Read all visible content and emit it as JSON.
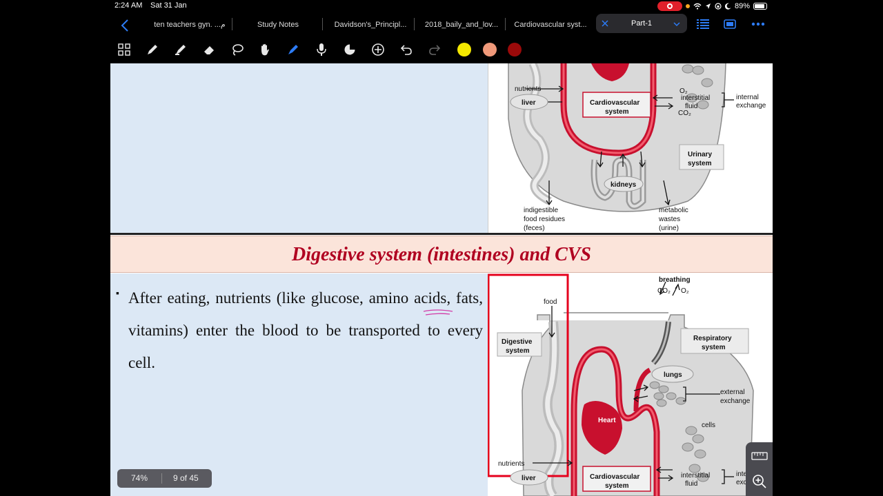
{
  "status": {
    "time": "2:24 AM",
    "date": "Sat 31 Jan",
    "battery": "89%"
  },
  "tabs": [
    {
      "label": "ten teachers gyn. ...م"
    },
    {
      "label": "Study Notes"
    },
    {
      "label": "Davidson's_Principl..."
    },
    {
      "label": "2018_baily_and_lov..."
    },
    {
      "label": "Cardiovascular syst..."
    },
    {
      "label": "Part-1"
    }
  ],
  "icons": {
    "back": "chevron-left-icon",
    "list": "list-icon",
    "layout": "page-layout-icon",
    "more": "more-icon"
  },
  "colors": {
    "yellow": "#f4e800",
    "peach": "#f0997a",
    "darkred": "#9b0a0a",
    "heading_text": "#b00020",
    "heading_bg": "#fbe4da",
    "panel_bg": "#dce8f5",
    "highlight_box": "#e5001c"
  },
  "slide": {
    "heading": "Digestive system (intestines) and CVS",
    "bullet_text": "After eating, nutrients (like glucose, amino acids, fats, vitamins) enter the blood to be transported to every cell."
  },
  "diagram_top": {
    "nutrients": "nutrients",
    "liver": "liver",
    "cv_line1": "Cardiovascular",
    "cv_line2": "system",
    "o2": "O₂",
    "co2": "CO₂",
    "interstitial1": "interstitial",
    "interstitial2": "fluid",
    "internal1": "internal",
    "internal2": "exchange",
    "urinary1": "Urinary",
    "urinary2": "system",
    "kidneys": "kidneys",
    "feces1": "indigestible",
    "feces2": "food residues",
    "feces3": "(feces)",
    "waste1": "metabolic",
    "waste2": "wastes",
    "waste3": "(urine)"
  },
  "diagram_bottom": {
    "breathing": "breathing",
    "co2": "CO₂",
    "o2": "O₂",
    "food": "food",
    "digestive1": "Digestive",
    "digestive2": "system",
    "respiratory1": "Respiratory",
    "respiratory2": "system",
    "lungs": "lungs",
    "external1": "external",
    "external2": "exchange",
    "heart": "Heart",
    "cells": "cells",
    "nutrients": "nutrients",
    "liver": "liver",
    "cv_line1": "Cardiovascular",
    "cv_line2": "system",
    "interstitial1": "interstitial",
    "interstitial2": "fluid",
    "internal1": "internal",
    "internal2": "exchange"
  },
  "footer": {
    "zoom": "74%",
    "page": "9 of 45"
  }
}
